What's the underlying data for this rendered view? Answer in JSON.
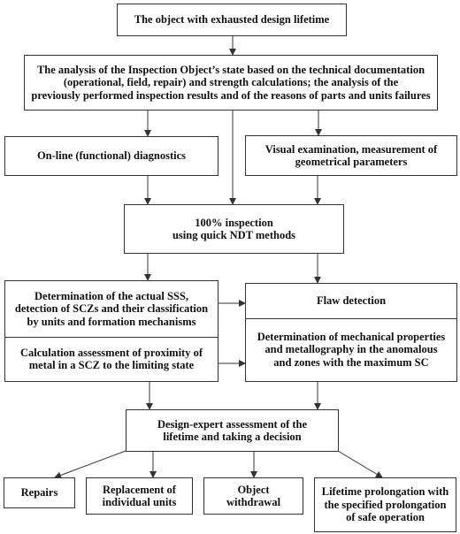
{
  "nodes": {
    "start": [
      "The object with exhausted design lifetime"
    ],
    "analysis": [
      "The analysis of the Inspection Object’s state based on the technical documentation",
      "(operational, field, repair) and strength calculations; the analysis of the",
      "previously performed inspection results and of the reasons of parts and units failures"
    ],
    "online_diagnostics": [
      "On-line (functional) diagnostics"
    ],
    "visual_exam": [
      "Visual examination, measurement of",
      "geometrical parameters"
    ],
    "inspection": [
      "100% inspection",
      "using quick NDT methods"
    ],
    "sss_determination": [
      "Determination of the actual SSS,",
      "detection of SCZs and their classification",
      "by units and formation mechanisms"
    ],
    "calc_assessment": [
      "Calculation assessment of proximity of",
      "metal in a SCZ to the limiting state"
    ],
    "flaw_detection": [
      "Flaw detection"
    ],
    "mech_properties": [
      "Determination of mechanical properties",
      "and metallography in the anomalous",
      "and zones with the maximum SC"
    ],
    "design_expert": [
      "Design-expert assessment of the",
      "lifetime and taking a decision"
    ],
    "repairs": [
      "Repairs"
    ],
    "replacement": [
      "Replacement of",
      "individual units"
    ],
    "withdrawal": [
      "Object",
      "withdrawal"
    ],
    "prolongation": [
      "Lifetime prolongation with",
      "the specified prolongation",
      "of safe operation"
    ]
  },
  "edges": [
    [
      "start",
      "analysis"
    ],
    [
      "analysis",
      "online_diagnostics"
    ],
    [
      "analysis",
      "inspection"
    ],
    [
      "analysis",
      "visual_exam"
    ],
    [
      "online_diagnostics",
      "inspection"
    ],
    [
      "visual_exam",
      "inspection"
    ],
    [
      "inspection",
      "sss_determination"
    ],
    [
      "inspection",
      "flaw_detection"
    ],
    [
      "sss_determination",
      "flaw_detection"
    ],
    [
      "calc_assessment",
      "mech_properties"
    ],
    [
      "calc_assessment",
      "design_expert"
    ],
    [
      "mech_properties",
      "design_expert"
    ],
    [
      "design_expert",
      "repairs"
    ],
    [
      "design_expert",
      "replacement"
    ],
    [
      "design_expert",
      "withdrawal"
    ],
    [
      "design_expert",
      "prolongation"
    ]
  ],
  "colors": {
    "line": "#333333",
    "text": "#111111",
    "background": "#ffffff"
  }
}
